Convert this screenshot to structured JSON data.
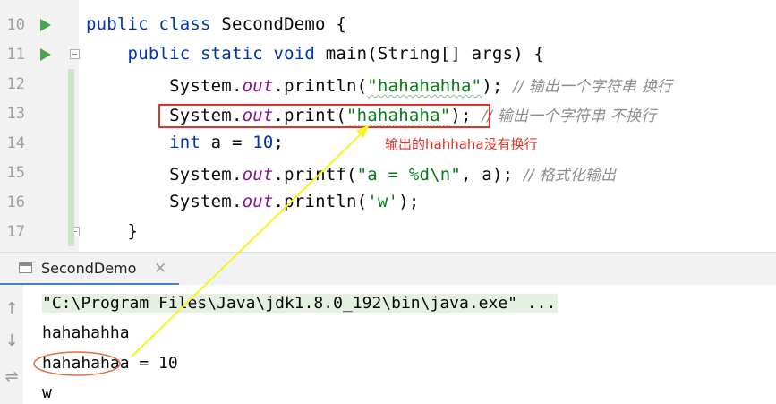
{
  "editor": {
    "lines": [
      {
        "num": "10",
        "run": true,
        "fold": false,
        "vcs": false,
        "tokens": [
          {
            "t": "public class",
            "c": "kw"
          },
          {
            "t": " SecondDemo {",
            "c": ""
          }
        ]
      },
      {
        "num": "11",
        "run": true,
        "fold": true,
        "vcs": false,
        "tokens": [
          {
            "t": "    public static void",
            "c": "kw"
          },
          {
            "t": " main(String[] args) {",
            "c": ""
          }
        ]
      },
      {
        "num": "12",
        "run": false,
        "fold": false,
        "vcs": true,
        "tokens": [
          {
            "t": "        System.",
            "c": ""
          },
          {
            "t": "out",
            "c": "fld"
          },
          {
            "t": ".println(",
            "c": ""
          },
          {
            "t": "\"hahahahha\"",
            "c": "str squig"
          },
          {
            "t": "); ",
            "c": ""
          },
          {
            "t": "// 输出一个字符串 换行",
            "c": "cmt"
          }
        ]
      },
      {
        "num": "13",
        "run": false,
        "fold": false,
        "vcs": true,
        "tokens": [
          {
            "t": "        System.",
            "c": ""
          },
          {
            "t": "out",
            "c": "fld"
          },
          {
            "t": ".print(",
            "c": ""
          },
          {
            "t": "\"hahahaha\"",
            "c": "str squig"
          },
          {
            "t": "); ",
            "c": ""
          },
          {
            "t": "// 输出一个字符串 不换行",
            "c": "cmt"
          }
        ]
      },
      {
        "num": "14",
        "run": false,
        "fold": false,
        "vcs": true,
        "tokens": [
          {
            "t": "        ",
            "c": ""
          },
          {
            "t": "int",
            "c": "kw"
          },
          {
            "t": " a = ",
            "c": ""
          },
          {
            "t": "10",
            "c": "kw"
          },
          {
            "t": ";",
            "c": ""
          }
        ]
      },
      {
        "num": "15",
        "run": false,
        "fold": false,
        "vcs": true,
        "tokens": [
          {
            "t": "        System.",
            "c": ""
          },
          {
            "t": "out",
            "c": "fld"
          },
          {
            "t": ".printf(",
            "c": ""
          },
          {
            "t": "\"a = %d\\n\"",
            "c": "str"
          },
          {
            "t": ", a); ",
            "c": ""
          },
          {
            "t": "// 格式化输出",
            "c": "cmt"
          }
        ]
      },
      {
        "num": "16",
        "run": false,
        "fold": false,
        "vcs": true,
        "tokens": [
          {
            "t": "        System.",
            "c": ""
          },
          {
            "t": "out",
            "c": "fld"
          },
          {
            "t": ".println(",
            "c": ""
          },
          {
            "t": "'w'",
            "c": "str"
          },
          {
            "t": ");",
            "c": ""
          }
        ]
      },
      {
        "num": "17",
        "run": false,
        "fold": true,
        "vcs": true,
        "tokens": [
          {
            "t": "    }",
            "c": ""
          }
        ]
      }
    ]
  },
  "annotation": {
    "text": "输出的hahhaha没有换行",
    "color": "#e0342a"
  },
  "run_window": {
    "tab_label": "SecondDemo",
    "close_glyph": "✕",
    "side_buttons": [
      "↑",
      "↓",
      "⇌"
    ],
    "console_lines": [
      "\"C:\\Program Files\\Java\\jdk1.8.0_192\\bin\\java.exe\" ...",
      "hahahahha",
      "hahahahaa = 10",
      "w"
    ]
  },
  "colors": {
    "keyword": "#0033b3",
    "string": "#067d17",
    "field": "#871094",
    "comment": "#8c8c8c",
    "run_icon": "#4aa64a",
    "arrow": "#f5f520",
    "ellipse": "#e07040"
  }
}
